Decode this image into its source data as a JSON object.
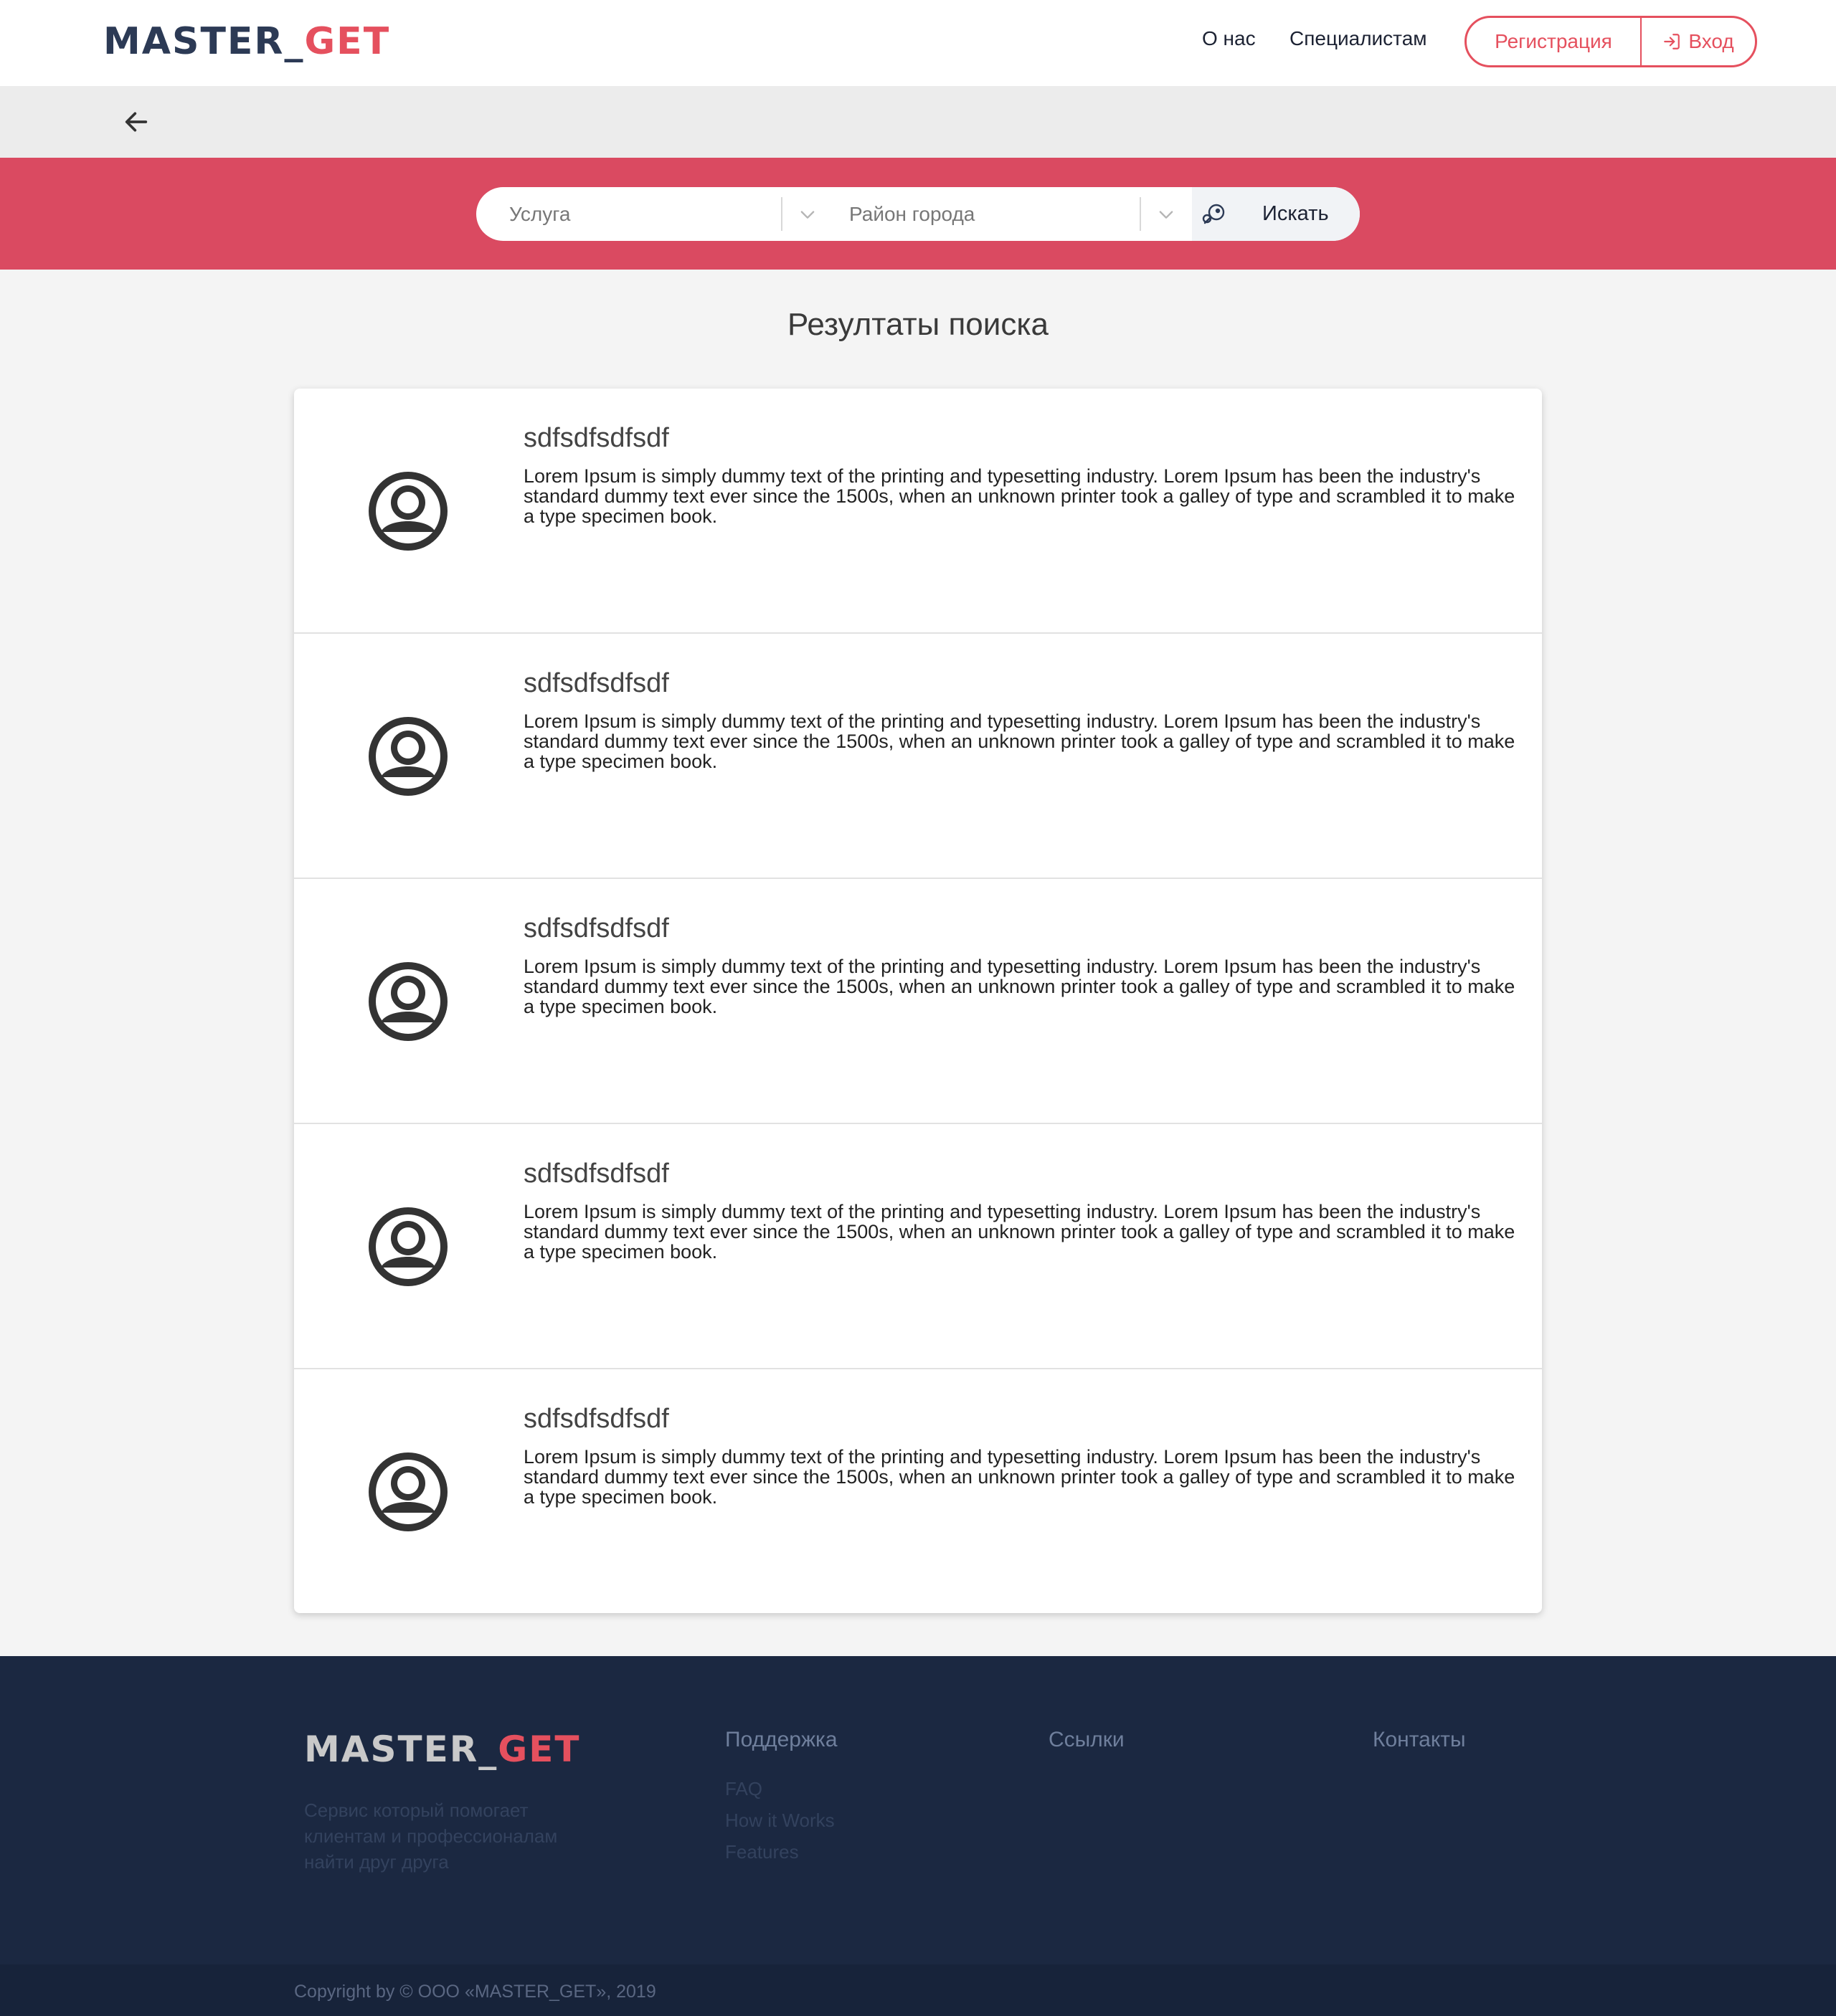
{
  "header": {
    "logo": {
      "part1": "MASTER_",
      "part2": "GET"
    },
    "nav": [
      "О нас",
      "Специалистам"
    ],
    "register_label": "Регистрация",
    "login_label": "Вход"
  },
  "search": {
    "service_placeholder": "Услуга",
    "district_placeholder": "Район города",
    "button_label": "Искать"
  },
  "results": {
    "title": "Резултаты поиска",
    "items": [
      {
        "name": "sdfsdfsdfsdf",
        "description": "Lorem Ipsum is simply dummy text of the printing and typesetting industry. Lorem Ipsum has been the industry's standard dummy text ever since the 1500s, when an unknown printer took a galley of type and scrambled it to make a type specimen book."
      },
      {
        "name": "sdfsdfsdfsdf",
        "description": "Lorem Ipsum is simply dummy text of the printing and typesetting industry. Lorem Ipsum has been the industry's standard dummy text ever since the 1500s, when an unknown printer took a galley of type and scrambled it to make a type specimen book."
      },
      {
        "name": "sdfsdfsdfsdf",
        "description": "Lorem Ipsum is simply dummy text of the printing and typesetting industry. Lorem Ipsum has been the industry's standard dummy text ever since the 1500s, when an unknown printer took a galley of type and scrambled it to make a type specimen book."
      },
      {
        "name": "sdfsdfsdfsdf",
        "description": "Lorem Ipsum is simply dummy text of the printing and typesetting industry. Lorem Ipsum has been the industry's standard dummy text ever since the 1500s, when an unknown printer took a galley of type and scrambled it to make a type specimen book."
      },
      {
        "name": "sdfsdfsdfsdf",
        "description": "Lorem Ipsum is simply dummy text of the printing and typesetting industry. Lorem Ipsum has been the industry's standard dummy text ever since the 1500s, when an unknown printer took a galley of type and scrambled it to make a type specimen book."
      }
    ]
  },
  "footer": {
    "logo": {
      "part1": "MASTER_",
      "part2": "GET"
    },
    "tagline": "Сервис который помогает клиентам и профессионалам найти друг друга",
    "support_heading": "Поддержка",
    "support_links": [
      "FAQ",
      "How it Works",
      "Features"
    ],
    "links_heading": "Ссылки",
    "contacts_heading": "Контакты",
    "copyright": "Copyright by © ООО «MASTER_GET», 2019"
  },
  "colors": {
    "accent": "#e5505e",
    "search_band": "#da4a61",
    "footer_bg": "#1b2841",
    "logo_dark": "#2c3a55"
  },
  "icons": [
    "back-arrow-icon",
    "chevron-down-icon",
    "login-icon",
    "search-icon",
    "user-avatar-icon"
  ]
}
